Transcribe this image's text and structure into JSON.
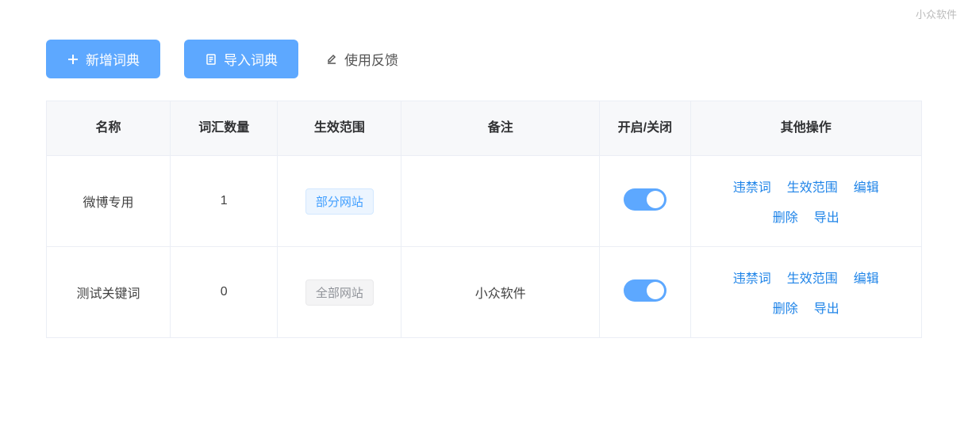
{
  "watermark": "小众软件",
  "toolbar": {
    "add_label": "新增词典",
    "import_label": "导入词典",
    "feedback_label": "使用反馈"
  },
  "table": {
    "headers": {
      "name": "名称",
      "count": "词汇数量",
      "scope": "生效范围",
      "note": "备注",
      "toggle": "开启/关闭",
      "ops": "其他操作"
    },
    "rows": [
      {
        "name": "微博专用",
        "count": "1",
        "scope_label": "部分网站",
        "scope_style": "blue",
        "note": "",
        "enabled": true
      },
      {
        "name": "测试关键词",
        "count": "0",
        "scope_label": "全部网站",
        "scope_style": "gray",
        "note": "小众软件",
        "enabled": true
      }
    ],
    "action_labels": {
      "banned": "违禁词",
      "scope": "生效范围",
      "edit": "编辑",
      "delete": "删除",
      "export": "导出"
    }
  }
}
